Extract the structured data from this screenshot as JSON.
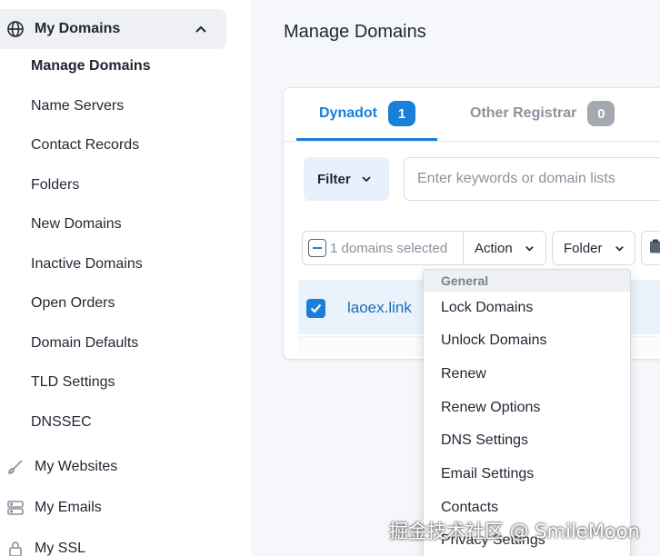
{
  "sidebar": {
    "my_domains": "My Domains",
    "items": [
      "Manage Domains",
      "Name Servers",
      "Contact Records",
      "Folders",
      "New Domains",
      "Inactive Domains",
      "Open Orders",
      "Domain Defaults",
      "TLD Settings",
      "DNSSEC"
    ],
    "my_websites": "My Websites",
    "my_emails": "My Emails",
    "my_ssl": "My SSL"
  },
  "page": {
    "title": "Manage Domains"
  },
  "tabs": [
    {
      "label": "Dynadot",
      "count": "1"
    },
    {
      "label": "Other Registrar",
      "count": "0"
    }
  ],
  "filter": {
    "label": "Filter",
    "search_placeholder": "Enter keywords or domain lists"
  },
  "toolbar": {
    "selected_text": "1 domains selected",
    "action_label": "Action",
    "folder_label": "Folder"
  },
  "domains": [
    {
      "name": "laoex.link"
    }
  ],
  "action_menu": {
    "header": "General",
    "items": [
      "Lock Domains",
      "Unlock Domains",
      "Renew",
      "Renew Options",
      "DNS Settings",
      "Email Settings",
      "Contacts",
      "Privacy Settings"
    ]
  },
  "watermark": "掘金技术社区 @ SmileMoon",
  "colors": {
    "accent": "#1a7fd8",
    "badge_gray": "#a4a9af",
    "row_selected": "#eaf2fb"
  }
}
